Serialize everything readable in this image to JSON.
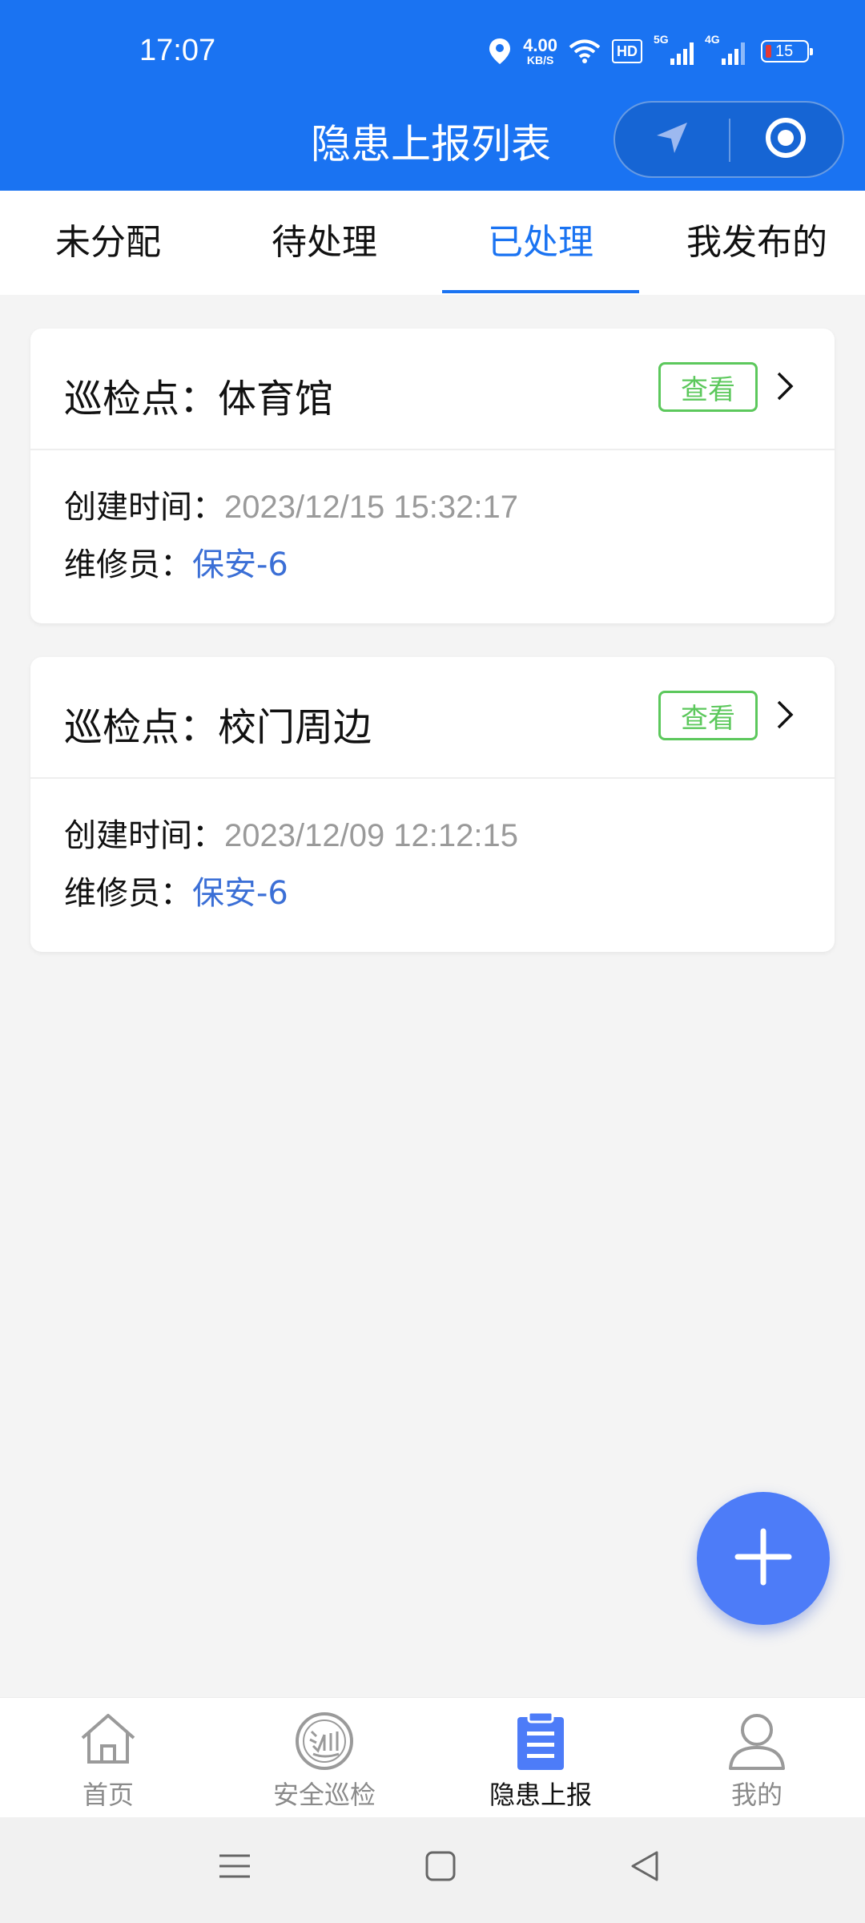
{
  "status_bar": {
    "time": "17:07",
    "speed_value": "4.00",
    "speed_unit": "KB/S",
    "hd_label": "HD",
    "signal1_label": "5G",
    "signal2_label": "4G",
    "battery_level": "15"
  },
  "header": {
    "title": "隐患上报列表",
    "capsule_icons": [
      "location-arrow-icon",
      "target-circle-icon"
    ]
  },
  "tabs": [
    {
      "label": "未分配",
      "active": false
    },
    {
      "label": "待处理",
      "active": false
    },
    {
      "label": "已处理",
      "active": true
    },
    {
      "label": "我发布的",
      "active": false
    }
  ],
  "labels": {
    "point_prefix": "巡检点：",
    "created_prefix": "创建时间：",
    "repairer_prefix": "维修员：",
    "view_button": "查看"
  },
  "cards": [
    {
      "point": "体育馆",
      "created": "2023/12/15 15:32:17",
      "repairer": "保安-6"
    },
    {
      "point": "校门周边",
      "created": "2023/12/09 12:12:15",
      "repairer": "保安-6"
    }
  ],
  "fab": {
    "icon": "plus-icon"
  },
  "bottom_nav": [
    {
      "label": "首页",
      "icon": "home-icon",
      "active": false
    },
    {
      "label": "安全巡检",
      "icon": "patrol-icon",
      "active": false
    },
    {
      "label": "隐患上报",
      "icon": "clipboard-icon",
      "active": true
    },
    {
      "label": "我的",
      "icon": "user-icon",
      "active": false
    }
  ],
  "colors": {
    "primary": "#1a73f2",
    "view_green": "#5cc85c",
    "repairer_blue": "#3b6fd6",
    "fab_blue": "#4d7cf8"
  }
}
